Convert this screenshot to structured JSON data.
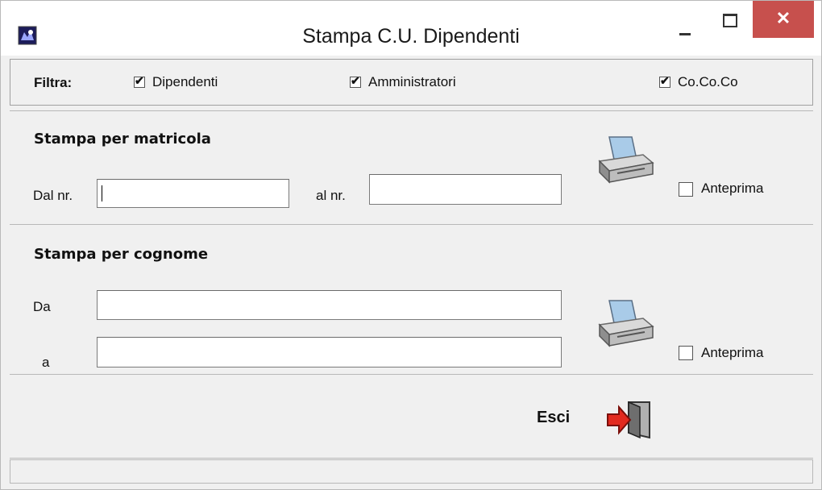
{
  "window": {
    "title": "Stampa C.U. Dipendenti",
    "close_glyph": "✕"
  },
  "filter": {
    "label": "Filtra:",
    "options": [
      {
        "label": "Dipendenti",
        "checked": true
      },
      {
        "label": "Amministratori",
        "checked": true
      },
      {
        "label": "Co.Co.Co",
        "checked": true
      }
    ]
  },
  "matricola": {
    "heading": "Stampa per matricola",
    "from_label": "Dal nr.",
    "from_value": "",
    "to_label": "al nr.",
    "to_value": "",
    "preview_label": "Anteprima",
    "preview_checked": false
  },
  "cognome": {
    "heading": "Stampa per cognome",
    "from_label": "Da",
    "from_value": "",
    "to_label": "a",
    "to_value": "",
    "preview_label": "Anteprima",
    "preview_checked": false
  },
  "footer": {
    "exit_label": "Esci"
  },
  "icons": {
    "print": "printer-icon",
    "exit": "exit-door-icon",
    "app": "app-icon"
  },
  "colors": {
    "close_bg": "#c7504d",
    "background": "#f0f0f0"
  }
}
